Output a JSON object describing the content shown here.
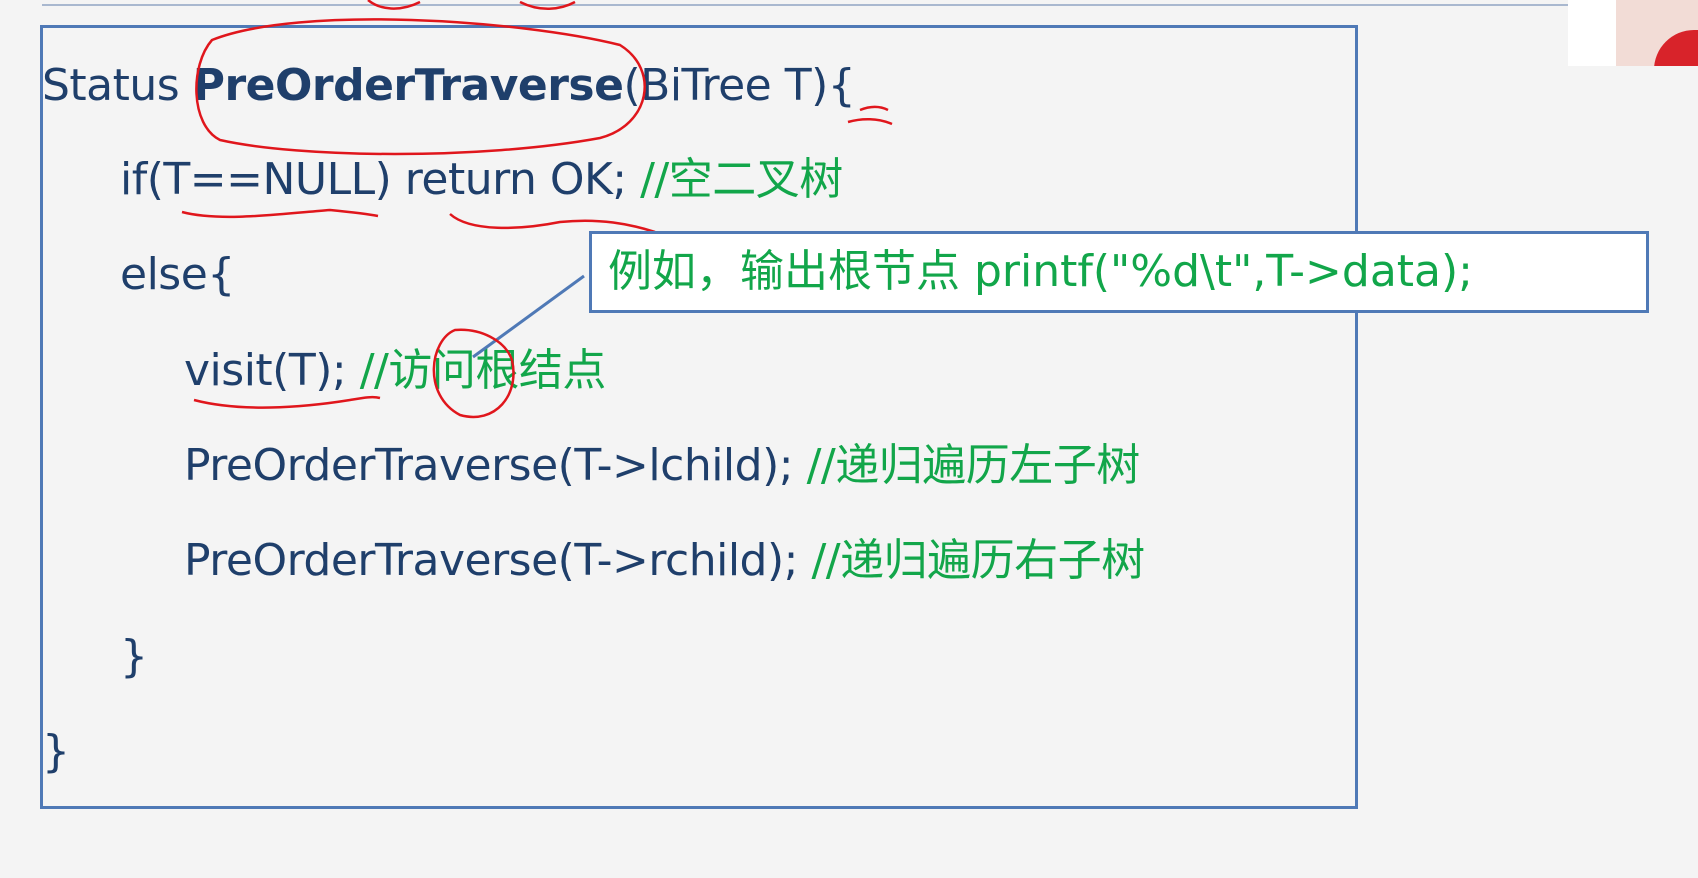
{
  "code": {
    "line1": {
      "prefix": "Status ",
      "func": "PreOrderTraverse",
      "params": "(BiTree T){"
    },
    "line2": {
      "code": "if(T==NULL) return OK; ",
      "comment": "//空二叉树"
    },
    "line3": {
      "code": "else{"
    },
    "line4": {
      "code": "visit(T); ",
      "comment": "//访问根结点"
    },
    "line5": {
      "code": "PreOrderTraverse(T->lchild); ",
      "comment": "//递归遍历左子树"
    },
    "line6": {
      "code": "PreOrderTraverse(T->rchild); ",
      "comment": "//递归遍历右子树"
    },
    "line7": {
      "code": "}"
    },
    "line8": {
      "code": "}"
    }
  },
  "callout": {
    "text": "例如，输出根节点 printf(\"%d\\t\",T->data);"
  },
  "colors": {
    "code": "#1f3f6b",
    "comment": "#12a64a",
    "border": "#4f79b6",
    "annotation": "#e0161c"
  }
}
